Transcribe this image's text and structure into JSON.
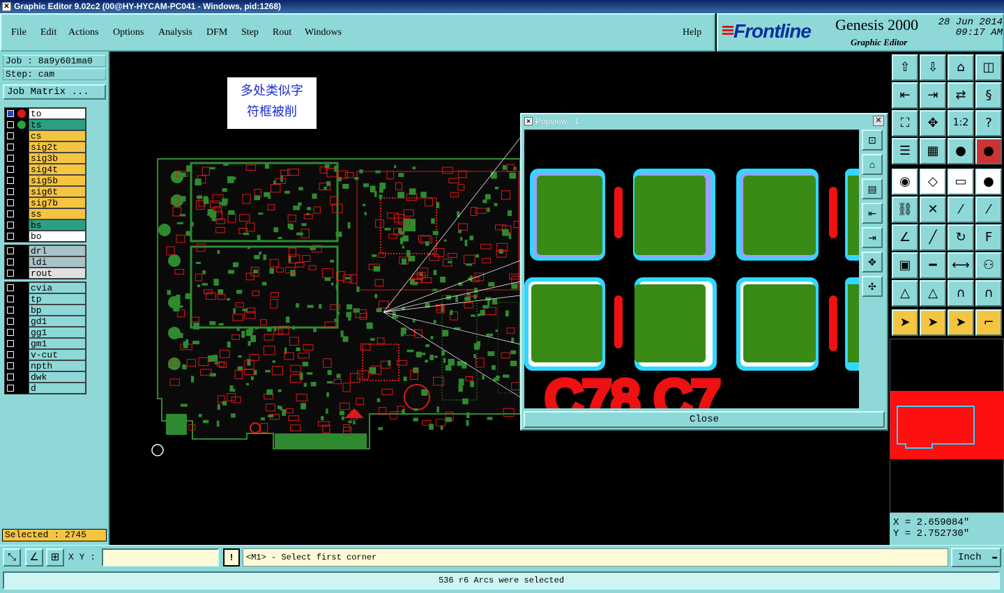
{
  "window": {
    "title": "Graphic Editor 9.02c2 (00@HY-HYCAM-PC041 - Windows, pid:1268)"
  },
  "menu": {
    "items": [
      "File",
      "Edit",
      "Actions",
      "Options",
      "Analysis",
      "DFM",
      "Step",
      "Rout",
      "Windows"
    ],
    "help": "Help"
  },
  "brand": {
    "logo": "Frontline",
    "product": "Genesis 2000",
    "subtitle": "Graphic Editor",
    "date": "28 Jun 2014",
    "time": "09:17 AM"
  },
  "job": {
    "job_label": "Job : 8a9y601ma0",
    "step_label": "Step: cam",
    "matrix_button": "Job Matrix ..."
  },
  "layers": {
    "board": [
      {
        "name": "to",
        "color": "#ffffff",
        "active": true
      },
      {
        "name": "ts",
        "color": "#2aa080"
      },
      {
        "name": "cs",
        "color": "#f5c542"
      },
      {
        "name": "sig2t",
        "color": "#f5c542"
      },
      {
        "name": "sig3b",
        "color": "#f5c542"
      },
      {
        "name": "sig4t",
        "color": "#f5c542"
      },
      {
        "name": "sig5b",
        "color": "#f5c542"
      },
      {
        "name": "sig6t",
        "color": "#f5c542"
      },
      {
        "name": "sig7b",
        "color": "#f5c542"
      },
      {
        "name": "ss",
        "color": "#f5c542"
      },
      {
        "name": "bs",
        "color": "#2aa080"
      },
      {
        "name": "bo",
        "color": "#ffffff"
      }
    ],
    "drill": [
      {
        "name": "drl",
        "color": "#a8c4c8"
      },
      {
        "name": "ldi",
        "color": "#a8c4c8"
      },
      {
        "name": "rout",
        "color": "#e0e0e0"
      }
    ],
    "misc": [
      {
        "name": "cvia",
        "color": "#8ed8d8"
      },
      {
        "name": "tp",
        "color": "#8ed8d8"
      },
      {
        "name": "bp",
        "color": "#8ed8d8"
      },
      {
        "name": "gd1",
        "color": "#8ed8d8"
      },
      {
        "name": "gg1",
        "color": "#8ed8d8"
      },
      {
        "name": "gm1",
        "color": "#8ed8d8"
      },
      {
        "name": "v-cut",
        "color": "#8ed8d8"
      },
      {
        "name": "npth",
        "color": "#8ed8d8"
      },
      {
        "name": "dwk",
        "color": "#8ed8d8"
      },
      {
        "name": "d",
        "color": "#8ed8d8"
      }
    ]
  },
  "selected": "Selected : 2745",
  "note": {
    "line1": "多处类似字",
    "line2": "符框被削"
  },
  "popview": {
    "title": "Popview - 1",
    "close_button": "Close",
    "silkscreen_text": "C78  C7"
  },
  "coords": {
    "x": "X = 2.659084\"",
    "y": "Y = 2.752730\""
  },
  "bottom": {
    "xy_label": "X Y :",
    "xy_value": "",
    "prompt": "<M1> - Select first corner",
    "unit": "Inch",
    "status": "536 r6 Arcs were selected"
  },
  "colors": {
    "panel": "#8ed8d8",
    "copper": "#2f8a2f",
    "silk": "#e01818",
    "highlight": "#f5c542"
  }
}
